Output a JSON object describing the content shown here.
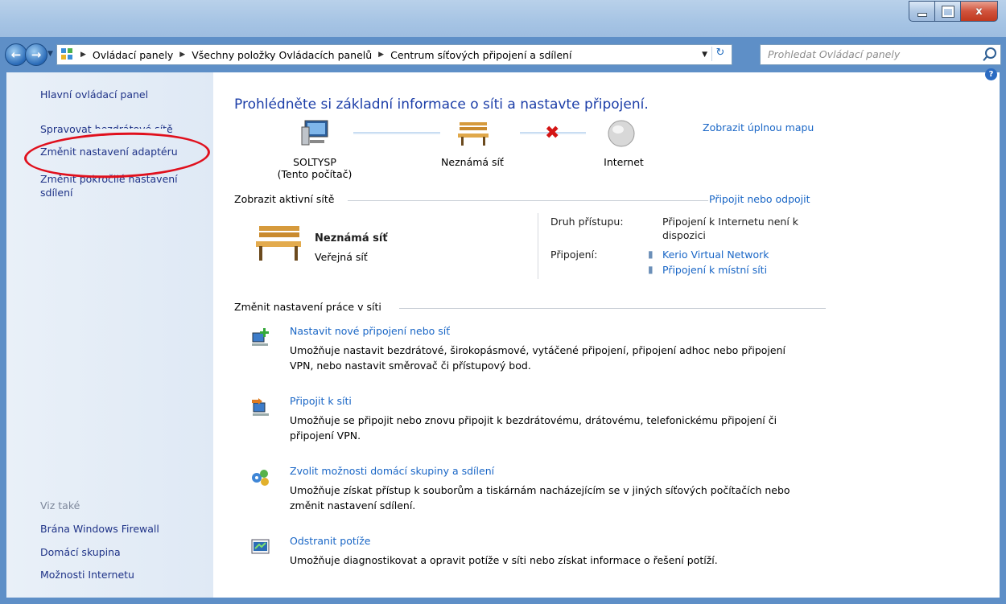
{
  "window": {
    "close_glyph": "x"
  },
  "address": {
    "crumbs": [
      "Ovládací panely",
      "Všechny položky Ovládacích panelů",
      "Centrum síťových připojení a sdílení"
    ],
    "search_placeholder": "Prohledat Ovládací panely"
  },
  "sidebar": {
    "items": [
      "Hlavní ovládací panel",
      "Spravovat bezdrátové sítě",
      "Změnit nastavení adaptéru",
      "Změnit pokročilé nastavení",
      "sdílení"
    ],
    "see_also_label": "Viz také",
    "see_also": [
      "Brána Windows Firewall",
      "Domácí skupina",
      "Možnosti Internetu"
    ]
  },
  "main": {
    "title": "Prohlédněte si základní informace o síti a nastavte připojení.",
    "map_link": "Zobrazit úplnou mapu",
    "map": {
      "computer_name": "SOLTYSP",
      "computer_sub": "(Tento počítač)",
      "network": "Neznámá síť",
      "internet": "Internet"
    },
    "active_header": "Zobrazit aktivní sítě",
    "connect_link": "Připojit nebo odpojit",
    "network_name": "Neznámá síť",
    "network_type": "Veřejná síť",
    "access_label": "Druh přístupu:",
    "access_value_1": "Připojení k Internetu není k",
    "access_value_2": "dispozici",
    "connections_label": "Připojení:",
    "connections": [
      "Kerio Virtual Network",
      "Připojení k místní síti"
    ],
    "change_header": "Změnit nastavení práce v síti",
    "tasks": [
      {
        "title": "Nastavit nové připojení nebo síť",
        "desc_1": "Umožňuje nastavit bezdrátové, širokopásmové, vytáčené připojení, připojení adhoc nebo připojení",
        "desc_2": "VPN, nebo nastavit směrovač či přístupový bod.",
        "icon": "new-connection-icon"
      },
      {
        "title": "Připojit k síti",
        "desc_1": "Umožňuje se připojit nebo znovu připojit k bezdrátovému, drátovému, telefonickému připojení či",
        "desc_2": "připojení VPN.",
        "icon": "connect-network-icon"
      },
      {
        "title": "Zvolit možnosti domácí skupiny a sdílení",
        "desc_1": "Umožňuje získat přístup k souborům a tiskárnám nacházejícím se v jiných síťových počítačích nebo",
        "desc_2": "změnit nastavení sdílení.",
        "icon": "homegroup-icon"
      },
      {
        "title": "Odstranit potíže",
        "desc_1": "Umožňuje diagnostikovat a opravit potíže v síti nebo získat informace o řešení potíží.",
        "desc_2": "",
        "icon": "troubleshoot-icon"
      }
    ]
  },
  "colors": {
    "link": "#1966c6",
    "title": "#1c3ea8",
    "annotation": "#e0101d"
  }
}
